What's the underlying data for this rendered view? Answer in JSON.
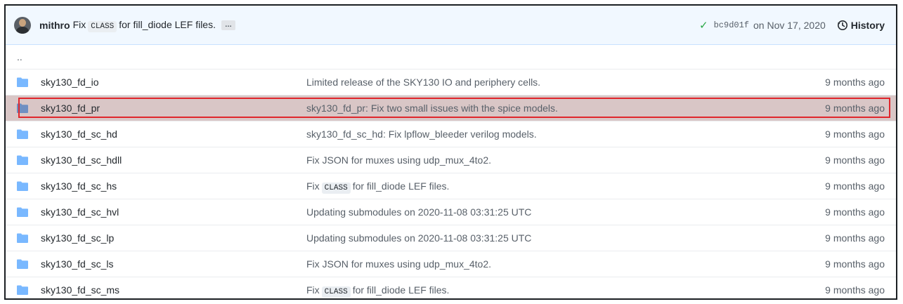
{
  "commit": {
    "author": "mithro",
    "message_pre": "Fix",
    "message_code": "CLASS",
    "message_post": "for fill_diode LEF files.",
    "ellipsis": "…",
    "sha": "bc9d01f",
    "date": "on Nov 17, 2020",
    "history_label": "History"
  },
  "parent_link": "..",
  "rows": [
    {
      "name": "sky130_fd_io",
      "message": "Limited release of the SKY130 IO and periphery cells.",
      "age": "9 months ago"
    },
    {
      "name": "sky130_fd_pr",
      "message": "sky130_fd_pr: Fix two small issues with the spice models.",
      "age": "9 months ago",
      "highlighted": true
    },
    {
      "name": "sky130_fd_sc_hd",
      "message": "sky130_fd_sc_hd: Fix lpflow_bleeder verilog models.",
      "age": "9 months ago"
    },
    {
      "name": "sky130_fd_sc_hdll",
      "message": "Fix JSON for muxes using udp_mux_4to2.",
      "age": "9 months ago"
    },
    {
      "name": "sky130_fd_sc_hs",
      "message_pre": "Fix",
      "message_code": "CLASS",
      "message_post": "for fill_diode LEF files.",
      "age": "9 months ago"
    },
    {
      "name": "sky130_fd_sc_hvl",
      "message": "Updating submodules on 2020-11-08 03:31:25 UTC",
      "age": "9 months ago"
    },
    {
      "name": "sky130_fd_sc_lp",
      "message": "Updating submodules on 2020-11-08 03:31:25 UTC",
      "age": "9 months ago"
    },
    {
      "name": "sky130_fd_sc_ls",
      "message": "Fix JSON for muxes using udp_mux_4to2.",
      "age": "9 months ago"
    },
    {
      "name": "sky130_fd_sc_ms",
      "message_pre": "Fix",
      "message_code": "CLASS",
      "message_post": "for fill_diode LEF files.",
      "age": "9 months ago"
    }
  ],
  "colors": {
    "folder": "#79b8ff",
    "highlight_border": "#e0262c",
    "check": "#28a745"
  },
  "icons": [
    "folder-icon",
    "check-icon",
    "history-icon"
  ]
}
